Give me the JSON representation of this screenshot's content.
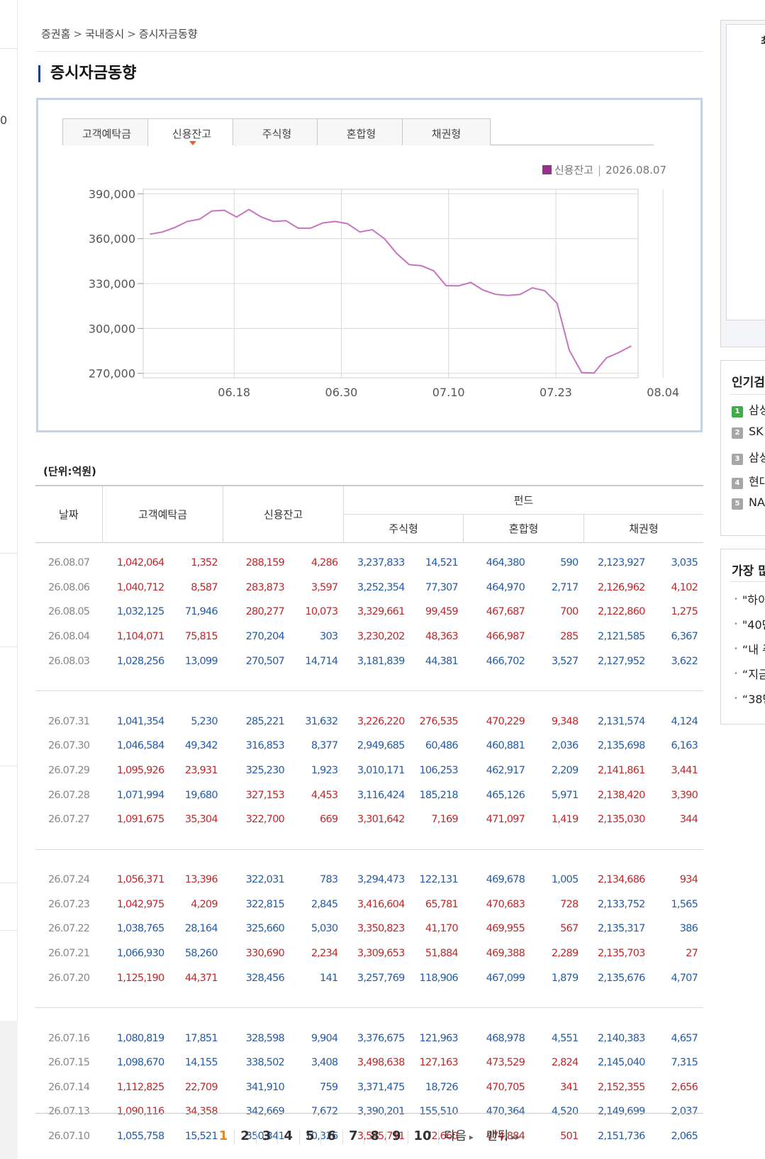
{
  "breadcrumb": [
    "증권홈",
    "국내증시",
    "증시자금동향"
  ],
  "breadcrumb_sep": ">",
  "page_title": "증시자금동향",
  "tabs": [
    {
      "label": "고객예탁금",
      "active": false
    },
    {
      "label": "신용잔고",
      "active": true
    },
    {
      "label": "주식형",
      "active": false
    },
    {
      "label": "혼합형",
      "active": false
    },
    {
      "label": "채권형",
      "active": false
    }
  ],
  "legend": {
    "series": "신용잔고",
    "date": "2026.08.07",
    "separator": "|",
    "color": "#9b2f8c"
  },
  "chart_data": {
    "type": "line",
    "series": [
      {
        "name": "신용잔고",
        "color": "#c873bd",
        "values": [
          363000,
          364500,
          367500,
          371500,
          373000,
          378500,
          379000,
          374500,
          379500,
          374500,
          371500,
          372000,
          367000,
          367000,
          370500,
          371500,
          370000,
          364500,
          366000,
          360000,
          350000,
          342669,
          341910,
          338502,
          328598,
          328456,
          330690,
          325660,
          322815,
          322031,
          322700,
          327153,
          325230,
          316853,
          285221,
          270507,
          270204,
          280277,
          283873,
          288159
        ]
      }
    ],
    "x_ticks": [
      "06.18",
      "06.30",
      "07.10",
      "07.23",
      "08.04"
    ],
    "x_tick_index": [
      6.8,
      15.5,
      24.2,
      32.9,
      41.6
    ],
    "y_ticks": [
      "390,000",
      "360,000",
      "330,000",
      "300,000",
      "270,000"
    ],
    "y_tick_values": [
      390000,
      360000,
      330000,
      300000,
      270000
    ],
    "ylim": [
      267000,
      393000
    ],
    "grid": true
  },
  "unit_label": "(단위:억원)",
  "table": {
    "headers": {
      "date": "날짜",
      "deposit": "고객예탁금",
      "credit": "신용잔고",
      "fund": "펀드",
      "stock": "주식형",
      "mixed": "혼합형",
      "bond": "채권형"
    },
    "groups": [
      [
        {
          "date": "26.08.07",
          "cells": [
            [
              "1,042,064",
              "up"
            ],
            [
              "1,352",
              "up"
            ],
            [
              "288,159",
              "up"
            ],
            [
              "4,286",
              "up"
            ],
            [
              "3,237,833",
              "down"
            ],
            [
              "14,521",
              "down"
            ],
            [
              "464,380",
              "down"
            ],
            [
              "590",
              "down"
            ],
            [
              "2,123,927",
              "down"
            ],
            [
              "3,035",
              "down"
            ]
          ]
        },
        {
          "date": "26.08.06",
          "cells": [
            [
              "1,040,712",
              "up"
            ],
            [
              "8,587",
              "up"
            ],
            [
              "283,873",
              "up"
            ],
            [
              "3,597",
              "up"
            ],
            [
              "3,252,354",
              "down"
            ],
            [
              "77,307",
              "down"
            ],
            [
              "464,970",
              "down"
            ],
            [
              "2,717",
              "down"
            ],
            [
              "2,126,962",
              "up"
            ],
            [
              "4,102",
              "up"
            ]
          ]
        },
        {
          "date": "26.08.05",
          "cells": [
            [
              "1,032,125",
              "down"
            ],
            [
              "71,946",
              "down"
            ],
            [
              "280,277",
              "up"
            ],
            [
              "10,073",
              "up"
            ],
            [
              "3,329,661",
              "up"
            ],
            [
              "99,459",
              "up"
            ],
            [
              "467,687",
              "up"
            ],
            [
              "700",
              "up"
            ],
            [
              "2,122,860",
              "up"
            ],
            [
              "1,275",
              "up"
            ]
          ]
        },
        {
          "date": "26.08.04",
          "cells": [
            [
              "1,104,071",
              "up"
            ],
            [
              "75,815",
              "up"
            ],
            [
              "270,204",
              "down"
            ],
            [
              "303",
              "down"
            ],
            [
              "3,230,202",
              "up"
            ],
            [
              "48,363",
              "up"
            ],
            [
              "466,987",
              "up"
            ],
            [
              "285",
              "up"
            ],
            [
              "2,121,585",
              "down"
            ],
            [
              "6,367",
              "down"
            ]
          ]
        },
        {
          "date": "26.08.03",
          "cells": [
            [
              "1,028,256",
              "down"
            ],
            [
              "13,099",
              "down"
            ],
            [
              "270,507",
              "down"
            ],
            [
              "14,714",
              "down"
            ],
            [
              "3,181,839",
              "down"
            ],
            [
              "44,381",
              "down"
            ],
            [
              "466,702",
              "down"
            ],
            [
              "3,527",
              "down"
            ],
            [
              "2,127,952",
              "down"
            ],
            [
              "3,622",
              "down"
            ]
          ]
        }
      ],
      [
        {
          "date": "26.07.31",
          "cells": [
            [
              "1,041,354",
              "down"
            ],
            [
              "5,230",
              "down"
            ],
            [
              "285,221",
              "down"
            ],
            [
              "31,632",
              "down"
            ],
            [
              "3,226,220",
              "up"
            ],
            [
              "276,535",
              "up"
            ],
            [
              "470,229",
              "up"
            ],
            [
              "9,348",
              "up"
            ],
            [
              "2,131,574",
              "down"
            ],
            [
              "4,124",
              "down"
            ]
          ]
        },
        {
          "date": "26.07.30",
          "cells": [
            [
              "1,046,584",
              "down"
            ],
            [
              "49,342",
              "down"
            ],
            [
              "316,853",
              "down"
            ],
            [
              "8,377",
              "down"
            ],
            [
              "2,949,685",
              "down"
            ],
            [
              "60,486",
              "down"
            ],
            [
              "460,881",
              "down"
            ],
            [
              "2,036",
              "down"
            ],
            [
              "2,135,698",
              "down"
            ],
            [
              "6,163",
              "down"
            ]
          ]
        },
        {
          "date": "26.07.29",
          "cells": [
            [
              "1,095,926",
              "up"
            ],
            [
              "23,931",
              "up"
            ],
            [
              "325,230",
              "down"
            ],
            [
              "1,923",
              "down"
            ],
            [
              "3,010,171",
              "down"
            ],
            [
              "106,253",
              "down"
            ],
            [
              "462,917",
              "down"
            ],
            [
              "2,209",
              "down"
            ],
            [
              "2,141,861",
              "up"
            ],
            [
              "3,441",
              "up"
            ]
          ]
        },
        {
          "date": "26.07.28",
          "cells": [
            [
              "1,071,994",
              "down"
            ],
            [
              "19,680",
              "down"
            ],
            [
              "327,153",
              "up"
            ],
            [
              "4,453",
              "up"
            ],
            [
              "3,116,424",
              "down"
            ],
            [
              "185,218",
              "down"
            ],
            [
              "465,126",
              "down"
            ],
            [
              "5,971",
              "down"
            ],
            [
              "2,138,420",
              "up"
            ],
            [
              "3,390",
              "up"
            ]
          ]
        },
        {
          "date": "26.07.27",
          "cells": [
            [
              "1,091,675",
              "up"
            ],
            [
              "35,304",
              "up"
            ],
            [
              "322,700",
              "up"
            ],
            [
              "669",
              "up"
            ],
            [
              "3,301,642",
              "up"
            ],
            [
              "7,169",
              "up"
            ],
            [
              "471,097",
              "up"
            ],
            [
              "1,419",
              "up"
            ],
            [
              "2,135,030",
              "up"
            ],
            [
              "344",
              "up"
            ]
          ]
        }
      ],
      [
        {
          "date": "26.07.24",
          "cells": [
            [
              "1,056,371",
              "up"
            ],
            [
              "13,396",
              "up"
            ],
            [
              "322,031",
              "down"
            ],
            [
              "783",
              "down"
            ],
            [
              "3,294,473",
              "down"
            ],
            [
              "122,131",
              "down"
            ],
            [
              "469,678",
              "down"
            ],
            [
              "1,005",
              "down"
            ],
            [
              "2,134,686",
              "up"
            ],
            [
              "934",
              "up"
            ]
          ]
        },
        {
          "date": "26.07.23",
          "cells": [
            [
              "1,042,975",
              "up"
            ],
            [
              "4,209",
              "up"
            ],
            [
              "322,815",
              "down"
            ],
            [
              "2,845",
              "down"
            ],
            [
              "3,416,604",
              "up"
            ],
            [
              "65,781",
              "up"
            ],
            [
              "470,683",
              "up"
            ],
            [
              "728",
              "up"
            ],
            [
              "2,133,752",
              "down"
            ],
            [
              "1,565",
              "down"
            ]
          ]
        },
        {
          "date": "26.07.22",
          "cells": [
            [
              "1,038,765",
              "down"
            ],
            [
              "28,164",
              "down"
            ],
            [
              "325,660",
              "down"
            ],
            [
              "5,030",
              "down"
            ],
            [
              "3,350,823",
              "up"
            ],
            [
              "41,170",
              "up"
            ],
            [
              "469,955",
              "up"
            ],
            [
              "567",
              "up"
            ],
            [
              "2,135,317",
              "down"
            ],
            [
              "386",
              "down"
            ]
          ]
        },
        {
          "date": "26.07.21",
          "cells": [
            [
              "1,066,930",
              "down"
            ],
            [
              "58,260",
              "down"
            ],
            [
              "330,690",
              "up"
            ],
            [
              "2,234",
              "up"
            ],
            [
              "3,309,653",
              "up"
            ],
            [
              "51,884",
              "up"
            ],
            [
              "469,388",
              "up"
            ],
            [
              "2,289",
              "up"
            ],
            [
              "2,135,703",
              "up"
            ],
            [
              "27",
              "up"
            ]
          ]
        },
        {
          "date": "26.07.20",
          "cells": [
            [
              "1,125,190",
              "up"
            ],
            [
              "44,371",
              "up"
            ],
            [
              "328,456",
              "down"
            ],
            [
              "141",
              "down"
            ],
            [
              "3,257,769",
              "down"
            ],
            [
              "118,906",
              "down"
            ],
            [
              "467,099",
              "down"
            ],
            [
              "1,879",
              "down"
            ],
            [
              "2,135,676",
              "down"
            ],
            [
              "4,707",
              "down"
            ]
          ]
        }
      ],
      [
        {
          "date": "26.07.16",
          "cells": [
            [
              "1,080,819",
              "down"
            ],
            [
              "17,851",
              "down"
            ],
            [
              "328,598",
              "down"
            ],
            [
              "9,904",
              "down"
            ],
            [
              "3,376,675",
              "down"
            ],
            [
              "121,963",
              "down"
            ],
            [
              "468,978",
              "down"
            ],
            [
              "4,551",
              "down"
            ],
            [
              "2,140,383",
              "down"
            ],
            [
              "4,657",
              "down"
            ]
          ]
        },
        {
          "date": "26.07.15",
          "cells": [
            [
              "1,098,670",
              "down"
            ],
            [
              "14,155",
              "down"
            ],
            [
              "338,502",
              "down"
            ],
            [
              "3,408",
              "down"
            ],
            [
              "3,498,638",
              "up"
            ],
            [
              "127,163",
              "up"
            ],
            [
              "473,529",
              "up"
            ],
            [
              "2,824",
              "up"
            ],
            [
              "2,145,040",
              "down"
            ],
            [
              "7,315",
              "down"
            ]
          ]
        },
        {
          "date": "26.07.14",
          "cells": [
            [
              "1,112,825",
              "up"
            ],
            [
              "22,709",
              "up"
            ],
            [
              "341,910",
              "down"
            ],
            [
              "759",
              "down"
            ],
            [
              "3,371,475",
              "down"
            ],
            [
              "18,726",
              "down"
            ],
            [
              "470,705",
              "up"
            ],
            [
              "341",
              "up"
            ],
            [
              "2,152,355",
              "up"
            ],
            [
              "2,656",
              "up"
            ]
          ]
        },
        {
          "date": "26.07.13",
          "cells": [
            [
              "1,090,116",
              "up"
            ],
            [
              "34,358",
              "up"
            ],
            [
              "342,669",
              "down"
            ],
            [
              "7,672",
              "down"
            ],
            [
              "3,390,201",
              "down"
            ],
            [
              "155,510",
              "down"
            ],
            [
              "470,364",
              "down"
            ],
            [
              "4,520",
              "down"
            ],
            [
              "2,149,699",
              "down"
            ],
            [
              "2,037",
              "down"
            ]
          ]
        },
        {
          "date": "26.07.10",
          "cells": [
            [
              "1,055,758",
              "down"
            ],
            [
              "15,521",
              "down"
            ],
            [
              "350,341",
              "down"
            ],
            [
              "10,326",
              "down"
            ],
            [
              "3,545,711",
              "up"
            ],
            [
              "72,660",
              "up"
            ],
            [
              "474,884",
              "up"
            ],
            [
              "501",
              "up"
            ],
            [
              "2,151,736",
              "down"
            ],
            [
              "2,065",
              "down"
            ]
          ]
        }
      ]
    ]
  },
  "pagination": {
    "pages": [
      "1",
      "2",
      "3",
      "4",
      "5",
      "6",
      "7",
      "8",
      "9",
      "10"
    ],
    "current": "1",
    "next": "다음",
    "next_arrow": "▸",
    "last": "맨뒤",
    "last_arrow": "▸▸"
  },
  "sidebar": {
    "box1_title": "최",
    "popular_title": "인기검",
    "popular": [
      {
        "rank": "1",
        "name": "삼성"
      },
      {
        "rank": "2",
        "name": "SK"
      },
      {
        "rank": "3",
        "name": "삼성"
      },
      {
        "rank": "4",
        "name": "현대"
      },
      {
        "rank": "5",
        "name": "NA"
      }
    ],
    "news_title": "가장 많",
    "news": [
      "\"하이",
      "\"40만",
      "“내 주",
      "“지금",
      "“38만"
    ]
  },
  "left_strip_digit": "0"
}
